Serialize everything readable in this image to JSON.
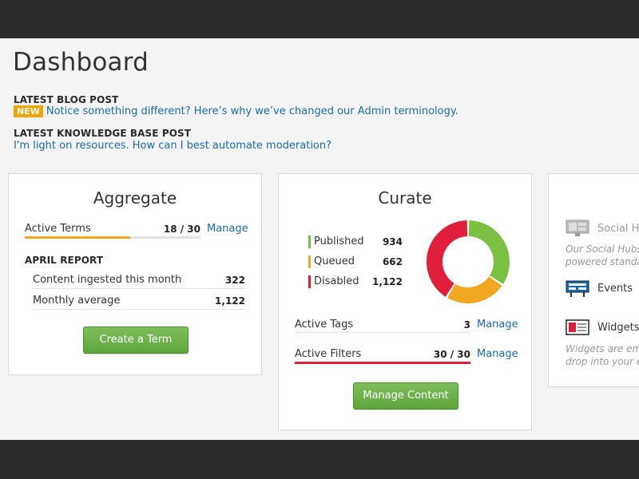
{
  "page": {
    "title": "Dashboard"
  },
  "news": {
    "blog_heading": "LATEST BLOG POST",
    "blog_badge": "NEW",
    "blog_link": "Notice something different? Here’s why we’ve changed our Admin terminology.",
    "kb_heading": "LATEST KNOWLEDGE BASE POST",
    "kb_link": "I'm light on resources. How can I best automate moderation?"
  },
  "aggregate": {
    "title": "Aggregate",
    "active_terms_label": "Active Terms",
    "active_terms_value": "18 / 30",
    "active_terms_fraction": 0.6,
    "manage_label": "Manage",
    "report_heading": "APRIL REPORT",
    "rows": [
      {
        "label": "Content ingested this month",
        "value": "322"
      },
      {
        "label": "Monthly average",
        "value": "1,122"
      }
    ],
    "button_label": "Create a Term"
  },
  "curate": {
    "title": "Curate",
    "legend": [
      {
        "label": "Published",
        "value": "934",
        "color": "#7ac143"
      },
      {
        "label": "Queued",
        "value": "662",
        "color": "#f0a823"
      },
      {
        "label": "Disabled",
        "value": "1,122",
        "color": "#e0203a"
      }
    ],
    "active_tags_label": "Active Tags",
    "active_tags_value": "3",
    "active_filters_label": "Active Filters",
    "active_filters_value": "30 / 30",
    "active_filters_fraction": 1.0,
    "manage_label": "Manage",
    "button_label": "Manage Content"
  },
  "chart_data": {
    "type": "pie",
    "categories": [
      "Published",
      "Queued",
      "Disabled"
    ],
    "values": [
      934,
      662,
      1122
    ],
    "colors": [
      "#7ac143",
      "#f0a823",
      "#e0203a"
    ]
  },
  "display": {
    "social_hubs_label": "Social Hu",
    "social_hubs_desc1": "Our Social Hubs",
    "social_hubs_desc2": "powered standa",
    "events_label": "Events",
    "widgets_label": "Widgets",
    "widgets_desc1": "Widgets are emb",
    "widgets_desc2": "drop into your e"
  },
  "colors": {
    "accent_link": "#1a6aab",
    "button_green": "#6ab04a",
    "progress_orange": "#f0a823",
    "progress_red": "#e0203a"
  }
}
